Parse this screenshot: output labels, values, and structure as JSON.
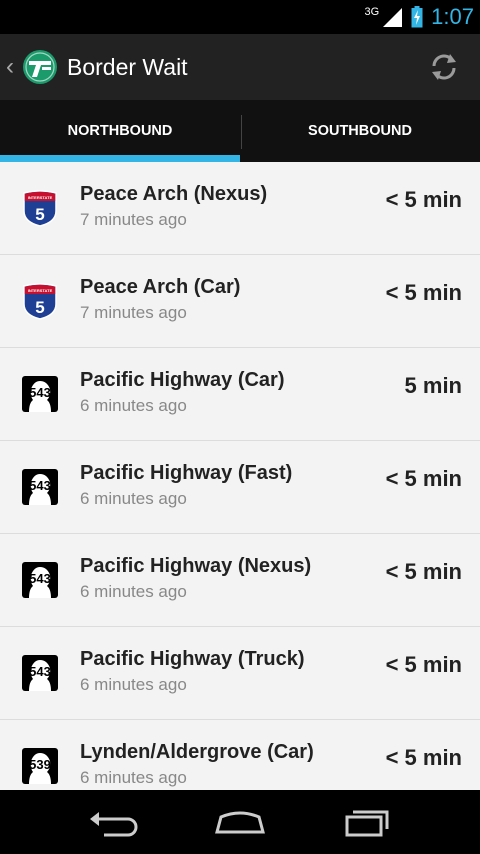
{
  "status": {
    "network": "3G",
    "time": "1:07"
  },
  "app": {
    "title": "Border Wait"
  },
  "tabs": [
    {
      "label": "NORTHBOUND",
      "selected": true
    },
    {
      "label": "SOUTHBOUND",
      "selected": false
    }
  ],
  "crossings": [
    {
      "name": "Peace Arch (Nexus)",
      "updated": "7 minutes ago",
      "wait": "< 5 min",
      "route": "5",
      "shield": "interstate",
      "shield_label": "INTERSTATE"
    },
    {
      "name": "Peace Arch (Car)",
      "updated": "7 minutes ago",
      "wait": "< 5 min",
      "route": "5",
      "shield": "interstate",
      "shield_label": "INTERSTATE"
    },
    {
      "name": "Pacific Highway (Car)",
      "updated": "6 minutes ago",
      "wait": "5 min",
      "route": "543",
      "shield": "state"
    },
    {
      "name": "Pacific Highway (Fast)",
      "updated": "6 minutes ago",
      "wait": "< 5 min",
      "route": "543",
      "shield": "state"
    },
    {
      "name": "Pacific Highway (Nexus)",
      "updated": "6 minutes ago",
      "wait": "< 5 min",
      "route": "543",
      "shield": "state"
    },
    {
      "name": "Pacific Highway (Truck)",
      "updated": "6 minutes ago",
      "wait": "< 5 min",
      "route": "543",
      "shield": "state"
    },
    {
      "name": "Lynden/Aldergrove (Car)",
      "updated": "6 minutes ago",
      "wait": "< 5 min",
      "route": "539",
      "shield": "state"
    }
  ],
  "colors": {
    "accent": "#33b5e5",
    "actionbar": "#222222",
    "interstate_blue": "#1f3f94",
    "interstate_red": "#c8102e"
  },
  "icons": {
    "up": "chevron-left-icon",
    "refresh": "refresh-icon",
    "back": "back-icon",
    "home": "home-icon",
    "recents": "recents-icon"
  }
}
